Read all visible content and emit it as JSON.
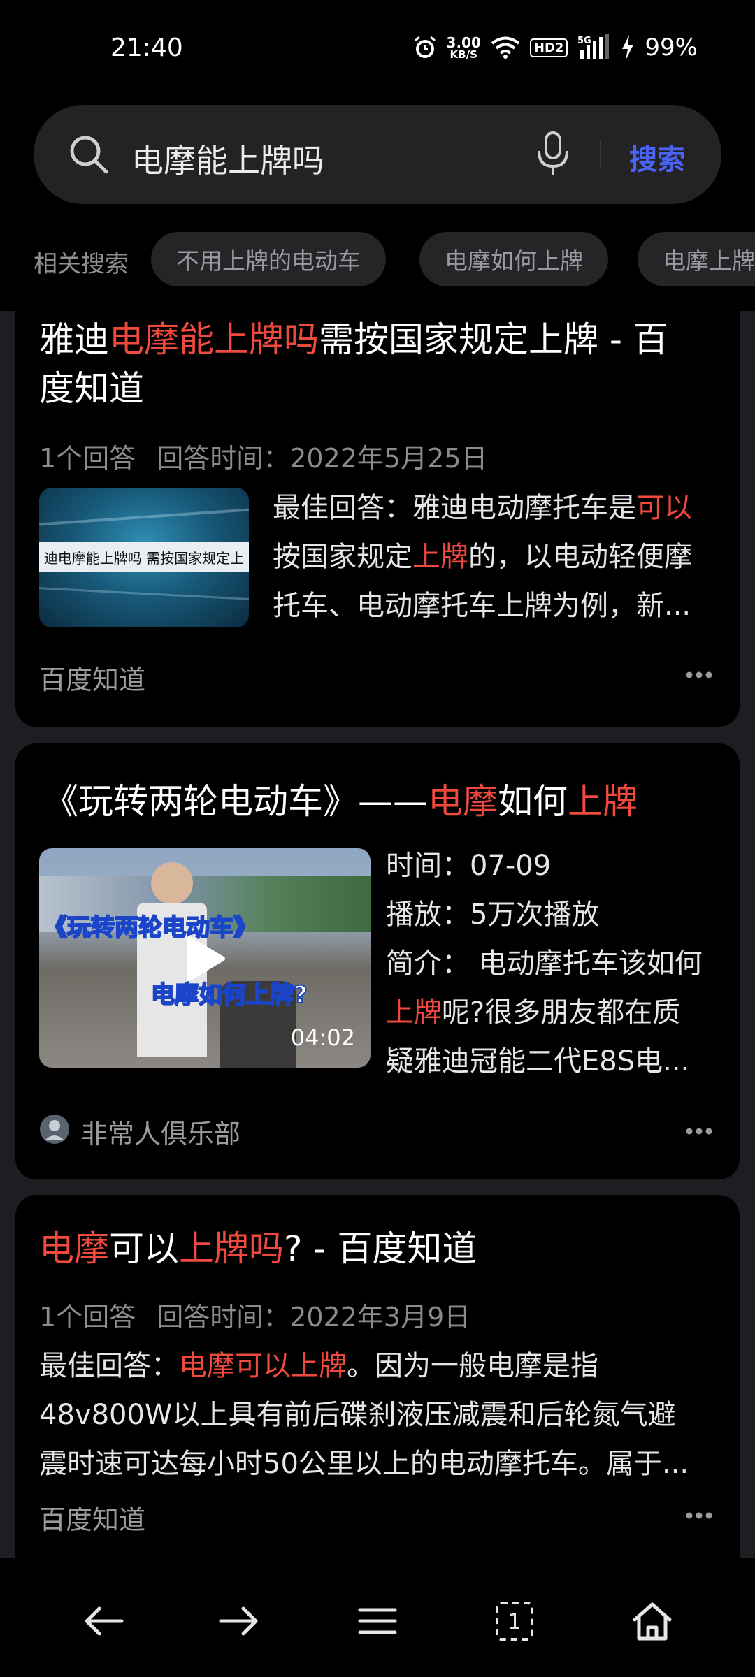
{
  "status": {
    "time": "21:40",
    "net_speed_value": "3.00",
    "net_speed_unit": "KB/S",
    "hd_label": "HD2",
    "signal_label": "5G",
    "battery": "99%"
  },
  "search": {
    "query": "电摩能上牌吗",
    "button_label": "搜索"
  },
  "related": {
    "label": "相关搜索",
    "chips": [
      "不用上牌的电动车",
      "电摩如何上牌",
      "电摩上牌"
    ]
  },
  "results": [
    {
      "title_parts": [
        "雅迪",
        "电摩能上牌吗",
        "需按国家规定上牌 - 百"
      ],
      "title_line2": "度知道",
      "meta_count": "1个回答",
      "meta_time": "回答时间：2022年5月25日",
      "thumb_text": "迪电摩能上牌吗 需按国家规定上",
      "body_lines": [
        [
          "最佳回答：雅迪电动摩托车是",
          "可以"
        ],
        [
          "按国家规定",
          "上牌",
          "的，以电动轻便摩"
        ],
        [
          "托车、电动摩托车上牌为例，新..."
        ]
      ],
      "source": "百度知道"
    },
    {
      "title_parts": [
        "《玩转两轮电动车》——",
        "电摩",
        "如何",
        "上牌"
      ],
      "thumb_line1": "《玩转两轮电动车》",
      "thumb_line2": "电摩如何上牌?",
      "duration": "04:02",
      "info_time": "时间：07-09",
      "info_play": "播放：5万次播放",
      "info_intro": "简介：  电动摩托车该如何",
      "info_line2_hl": "上牌",
      "info_line2_rest": "呢?很多朋友都在质",
      "info_line3": "疑雅迪冠能二代E8S电...",
      "source": "非常人俱乐部"
    },
    {
      "title_parts": [
        "电摩",
        "可以",
        "上牌吗",
        "? - 百度知道"
      ],
      "meta_count": "1个回答",
      "meta_time": "回答时间：2022年3月9日",
      "body_line1_a": "最佳回答：",
      "body_line1_hl": "电摩可以上牌",
      "body_line1_b": "。因为一般电摩是指",
      "body_line2": "48v800W以上具有前后碟刹液压减震和后轮氮气避",
      "body_line3": "震时速可达每小时50公里以上的电动摩托车。属于...",
      "source": "百度知道"
    }
  ],
  "colors": {
    "highlight": "#f04a3e",
    "search_button": "#4a63f7",
    "card_bg": "#000000",
    "page_bg": "#1c1e21"
  }
}
